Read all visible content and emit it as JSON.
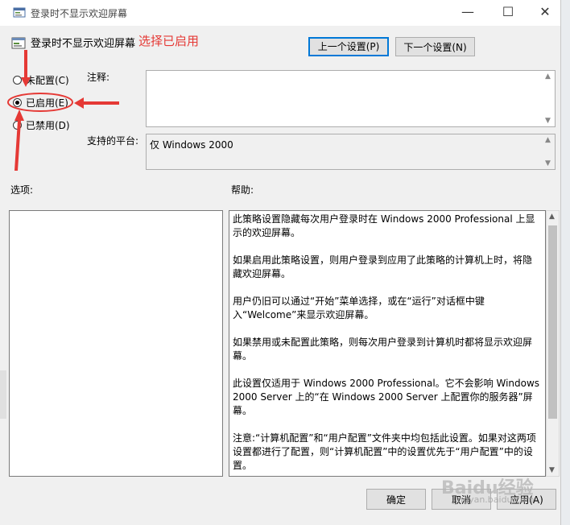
{
  "window": {
    "title": "登录时不显示欢迎屏幕",
    "min": "—",
    "max": "☐",
    "close": "✕"
  },
  "header": {
    "policy_title": "登录时不显示欢迎屏幕",
    "annotation": "选择已启用",
    "prev_button": "上一个设置(P)",
    "next_button": "下一个设置(N)"
  },
  "state": {
    "options": [
      {
        "label": "未配置(C)",
        "checked": false
      },
      {
        "label": "已启用(E)",
        "checked": true
      },
      {
        "label": "已禁用(D)",
        "checked": false
      }
    ]
  },
  "comment": {
    "label": "注释:",
    "value": ""
  },
  "platform": {
    "label": "支持的平台:",
    "value": "仅 Windows 2000"
  },
  "options_pane": {
    "label": "选项:"
  },
  "help_pane": {
    "label": "帮助:",
    "paragraphs": [
      "此策略设置隐藏每次用户登录时在 Windows 2000 Professional 上显示的欢迎屏幕。",
      "如果启用此策略设置，则用户登录到应用了此策略的计算机上时，将隐藏欢迎屏幕。",
      "用户仍旧可以通过“开始”菜单选择，或在“运行”对话框中键入“Welcome”来显示欢迎屏幕。",
      "如果禁用或未配置此策略，则每次用户登录到计算机时都将显示欢迎屏幕。",
      "此设置仅适用于 Windows 2000 Professional。它不会影响 Windows 2000 Server 上的“在 Windows 2000 Server 上配置你的服务器”屏幕。",
      "注意:“计算机配置”和“用户配置”文件夹中均包括此设置。如果对这两项设置都进行了配置，则“计算机配置”中的设置优先于“用户配置”中的设置。"
    ]
  },
  "footer": {
    "ok": "确定",
    "cancel": "取消",
    "apply": "应用(A)"
  },
  "watermark": {
    "text": "Baidu经验",
    "sub": "jingyan.baidu.com"
  },
  "colors": {
    "accent": "#0078d7",
    "annotation": "#e53935"
  }
}
